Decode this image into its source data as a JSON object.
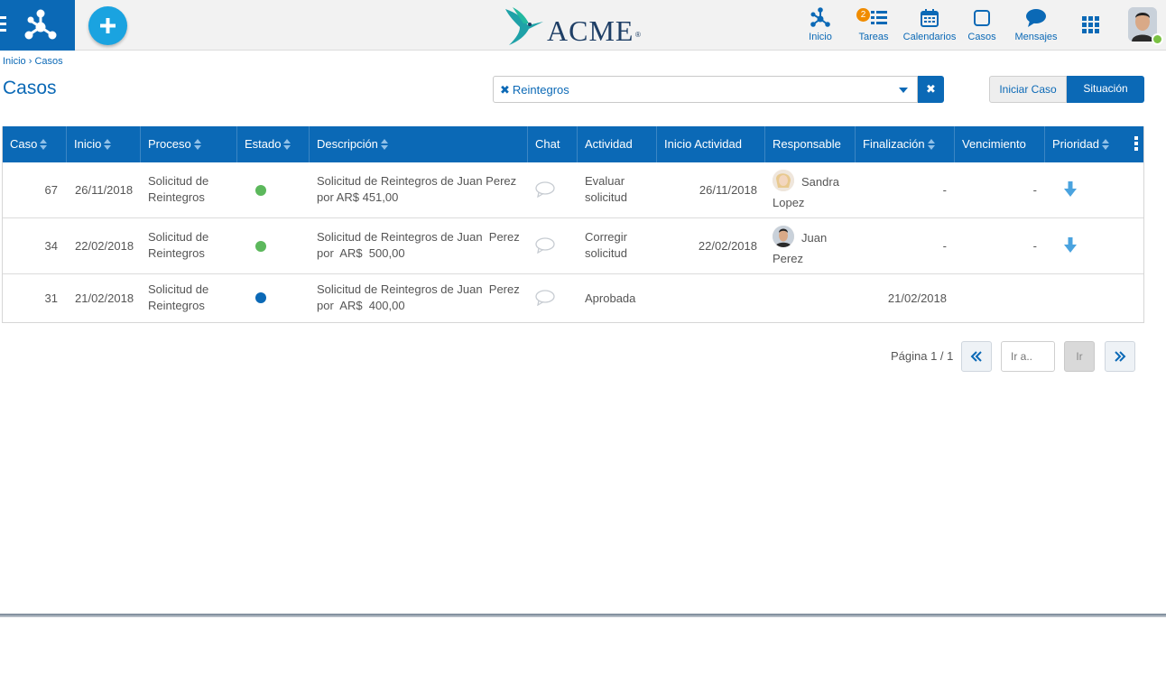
{
  "topbar": {
    "brand": "ACME",
    "brand_mark": "®",
    "nav": [
      {
        "label": "Inicio",
        "icon": "network-icon"
      },
      {
        "label": "Tareas",
        "icon": "tasks-icon",
        "badge": "2"
      },
      {
        "label": "Calendarios",
        "icon": "calendar-icon"
      },
      {
        "label": "Casos",
        "icon": "square-icon"
      },
      {
        "label": "Mensajes",
        "icon": "chat-bubble-icon"
      }
    ]
  },
  "breadcrumb": {
    "home": "Inicio",
    "separator": "›",
    "current": "Casos"
  },
  "page": {
    "title": "Casos"
  },
  "filter": {
    "tag": "Reintegros",
    "tag_remove": "✖",
    "clear": "✖"
  },
  "actions": {
    "iniciar": "Iniciar Caso",
    "situacion": "Situación"
  },
  "table": {
    "columns": [
      "Caso",
      "Inicio",
      "Proceso",
      "Estado",
      "Descripción",
      "Chat",
      "Actividad",
      "Inicio Actividad",
      "Responsable",
      "Finalización",
      "Vencimiento",
      "Prioridad"
    ],
    "rows": [
      {
        "caso": "67",
        "inicio": "26/11/2018",
        "proceso": "Solicitud de Reintegros",
        "estado_color": "#5cb85c",
        "descripcion": "Solicitud de Reintegros de Juan Perez por AR$ 451,00",
        "actividad": "Evaluar solicitud",
        "inicio_actividad": "26/11/2018",
        "responsable": "Sandra Lopez",
        "finalizacion": "-",
        "vencimiento": "-",
        "prioridad": "low-priority-arrow-icon"
      },
      {
        "caso": "34",
        "inicio": "22/02/2018",
        "proceso": "Solicitud de Reintegros",
        "estado_color": "#5cb85c",
        "descripcion": "Solicitud de Reintegros de Juan  Perez por  AR$  500,00",
        "actividad": "Corregir solicitud",
        "inicio_actividad": "22/02/2018",
        "responsable": "Juan Perez",
        "finalizacion": "-",
        "vencimiento": "-",
        "prioridad": "low-priority-arrow-icon"
      },
      {
        "caso": "31",
        "inicio": "21/02/2018",
        "proceso": "Solicitud de Reintegros",
        "estado_color": "#0b69b6",
        "descripcion": "Solicitud de Reintegros de Juan  Perez por  AR$  400,00",
        "actividad": "Aprobada",
        "inicio_actividad": "",
        "responsable": "",
        "finalizacion": "21/02/2018",
        "vencimiento": "",
        "prioridad": ""
      }
    ]
  },
  "pager": {
    "text": "Página 1 / 1",
    "goto_placeholder": "Ir a..",
    "go": "Ir"
  },
  "colors": {
    "primary": "#0b69b6",
    "accent": "#1aa3e0",
    "badge": "#f08c00",
    "online": "#7ac143"
  }
}
